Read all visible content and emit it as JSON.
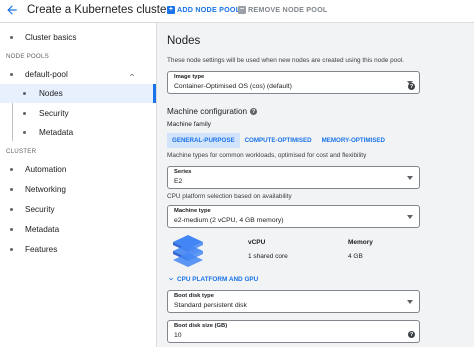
{
  "header": {
    "back_icon": "arrow-back-icon",
    "title": "Create a Kubernetes cluster",
    "add_node_pool": "ADD NODE POOL",
    "remove_node_pool": "REMOVE NODE POOL"
  },
  "sidebar": {
    "items_top": [
      {
        "label": "Cluster basics"
      }
    ],
    "node_pools_heading": "NODE POOLS",
    "pool": {
      "label": "default-pool",
      "expanded": true
    },
    "pool_children": [
      {
        "label": "Nodes",
        "active": true
      },
      {
        "label": "Security"
      },
      {
        "label": "Metadata"
      }
    ],
    "cluster_heading": "CLUSTER",
    "cluster_items": [
      {
        "label": "Automation"
      },
      {
        "label": "Networking"
      },
      {
        "label": "Security"
      },
      {
        "label": "Metadata"
      },
      {
        "label": "Features"
      }
    ]
  },
  "main": {
    "title": "Nodes",
    "description": "These node settings will be used when new nodes are created using this node pool.",
    "image_type": {
      "label": "Image type",
      "value": "Container-Optimised OS (cos) (default)"
    },
    "machine_config": {
      "heading": "Machine configuration",
      "family_label": "Machine family",
      "tabs": [
        "GENERAL-PURPOSE",
        "COMPUTE-OPTIMISED",
        "MEMORY-OPTIMISED"
      ],
      "selected_tab": 0,
      "family_desc": "Machine types for common workloads, optimised for cost and flexibility",
      "series": {
        "label": "Series",
        "value": "E2"
      },
      "series_desc": "CPU platform selection based on availability",
      "machine_type": {
        "label": "Machine type",
        "value": "e2-medium (2 vCPU, 4 GB memory)"
      },
      "vcpu_label": "vCPU",
      "vcpu_value": "1 shared core",
      "memory_label": "Memory",
      "memory_value": "4 GB",
      "cpu_platform_link": "CPU PLATFORM AND GPU"
    },
    "boot_disk_type": {
      "label": "Boot disk type",
      "value": "Standard persistent disk"
    },
    "boot_disk_size": {
      "label": "Boot disk size (GB)",
      "value": "10"
    }
  },
  "colors": {
    "accent": "#1a73e8",
    "active_bg": "#e8f0fe",
    "tab_selected_bg": "#d2e3fc",
    "main_bg": "#f1f3f4"
  }
}
